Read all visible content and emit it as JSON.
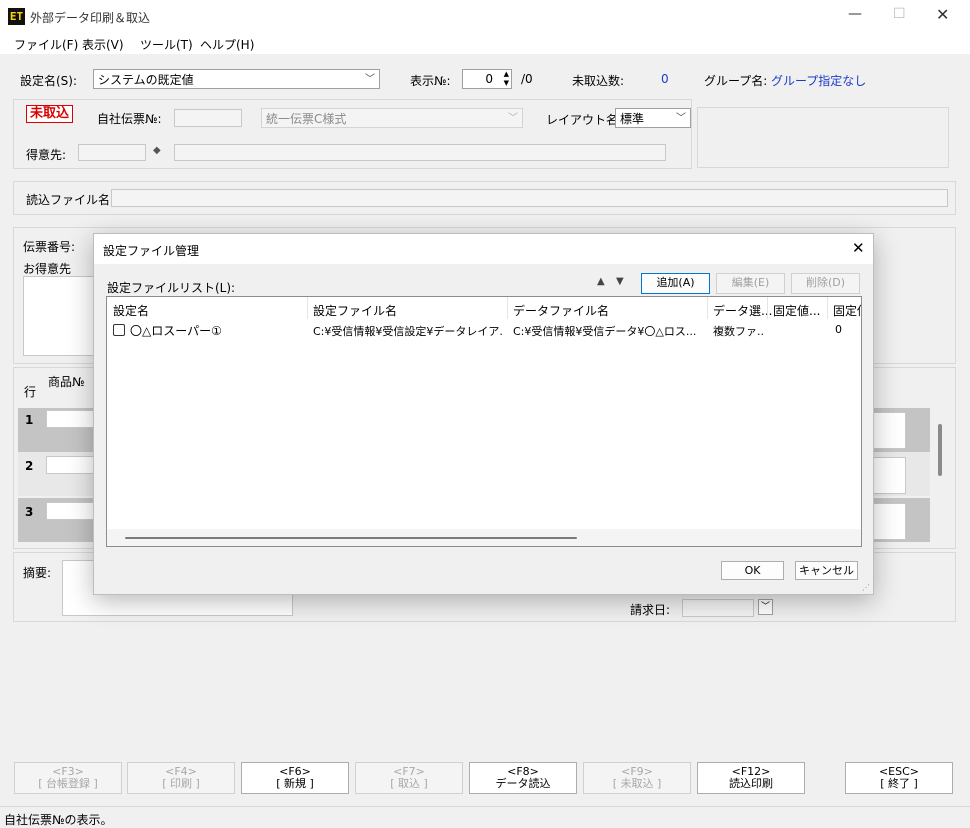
{
  "window": {
    "app_icon": "ET",
    "title": "外部データ印刷＆取込"
  },
  "window_controls": {
    "minimize": "—",
    "maximize": "☐",
    "close": "✕"
  },
  "menu": [
    "ファイル(F)",
    "表示(V)",
    "ツール(T)",
    "ヘルプ(H)"
  ],
  "header": {
    "setting_label": "設定名(S):",
    "setting_value": "システムの既定値",
    "display_no_label": "表示№:",
    "display_no_value": "0",
    "display_no_total": "/0",
    "unimported_label": "未取込数:",
    "unimported_value": "0",
    "group_label": "グループ名:",
    "group_value": "グループ指定なし"
  },
  "info": {
    "status_badge": "未取込",
    "own_slip_label": "自社伝票№:",
    "slip_format": "統一伝票C様式",
    "layout_label": "レイアウト名:",
    "layout_value": "標準",
    "customer_label": "得意先:",
    "customer_mark": "◆"
  },
  "import_file_label": "読込ファイル名:",
  "slip": {
    "slip_no_label": "伝票番号:",
    "customer_label": "お得意先",
    "row_header": "行",
    "product_header": "商品№",
    "rows": [
      "1",
      "2",
      "3"
    ],
    "summary_label": "摘要:",
    "billing_date_label": "請求日:"
  },
  "fkeys": [
    {
      "key": "<F3>",
      "label": "[ 台帳登録 ]",
      "enabled": false
    },
    {
      "key": "<F4>",
      "label": "[ 印刷 ]",
      "enabled": false
    },
    {
      "key": "<F6>",
      "label": "[ 新規 ]",
      "enabled": true
    },
    {
      "key": "<F7>",
      "label": "[ 取込 ]",
      "enabled": false
    },
    {
      "key": "<F8>",
      "label": "データ読込",
      "enabled": true
    },
    {
      "key": "<F9>",
      "label": "[ 未取込 ]",
      "enabled": false
    },
    {
      "key": "<F12>",
      "label": "読込印刷",
      "enabled": true
    },
    {
      "key": "<ESC>",
      "label": "[ 終了 ]",
      "enabled": true
    }
  ],
  "statusbar": "自社伝票№の表示。",
  "dialog": {
    "title": "設定ファイル管理",
    "list_label": "設定ファイルリスト(L):",
    "add_button": "追加(A)",
    "edit_button": "編集(E)",
    "delete_button": "削除(D)",
    "columns": [
      "設定名",
      "設定ファイル名",
      "データファイル名",
      "データ選...",
      "固定値...",
      "固定値"
    ],
    "rows": [
      {
        "name": "〇△ロスーパー①",
        "setting_file": "C:¥受信情報¥受信設定¥データレイア...",
        "data_file": "C:¥受信情報¥受信データ¥〇△ロス...",
        "data_select": "複数ファ...",
        "fixed1": "",
        "fixed2": "0"
      }
    ],
    "ok_button": "OK",
    "cancel_button": "キャンセル"
  }
}
